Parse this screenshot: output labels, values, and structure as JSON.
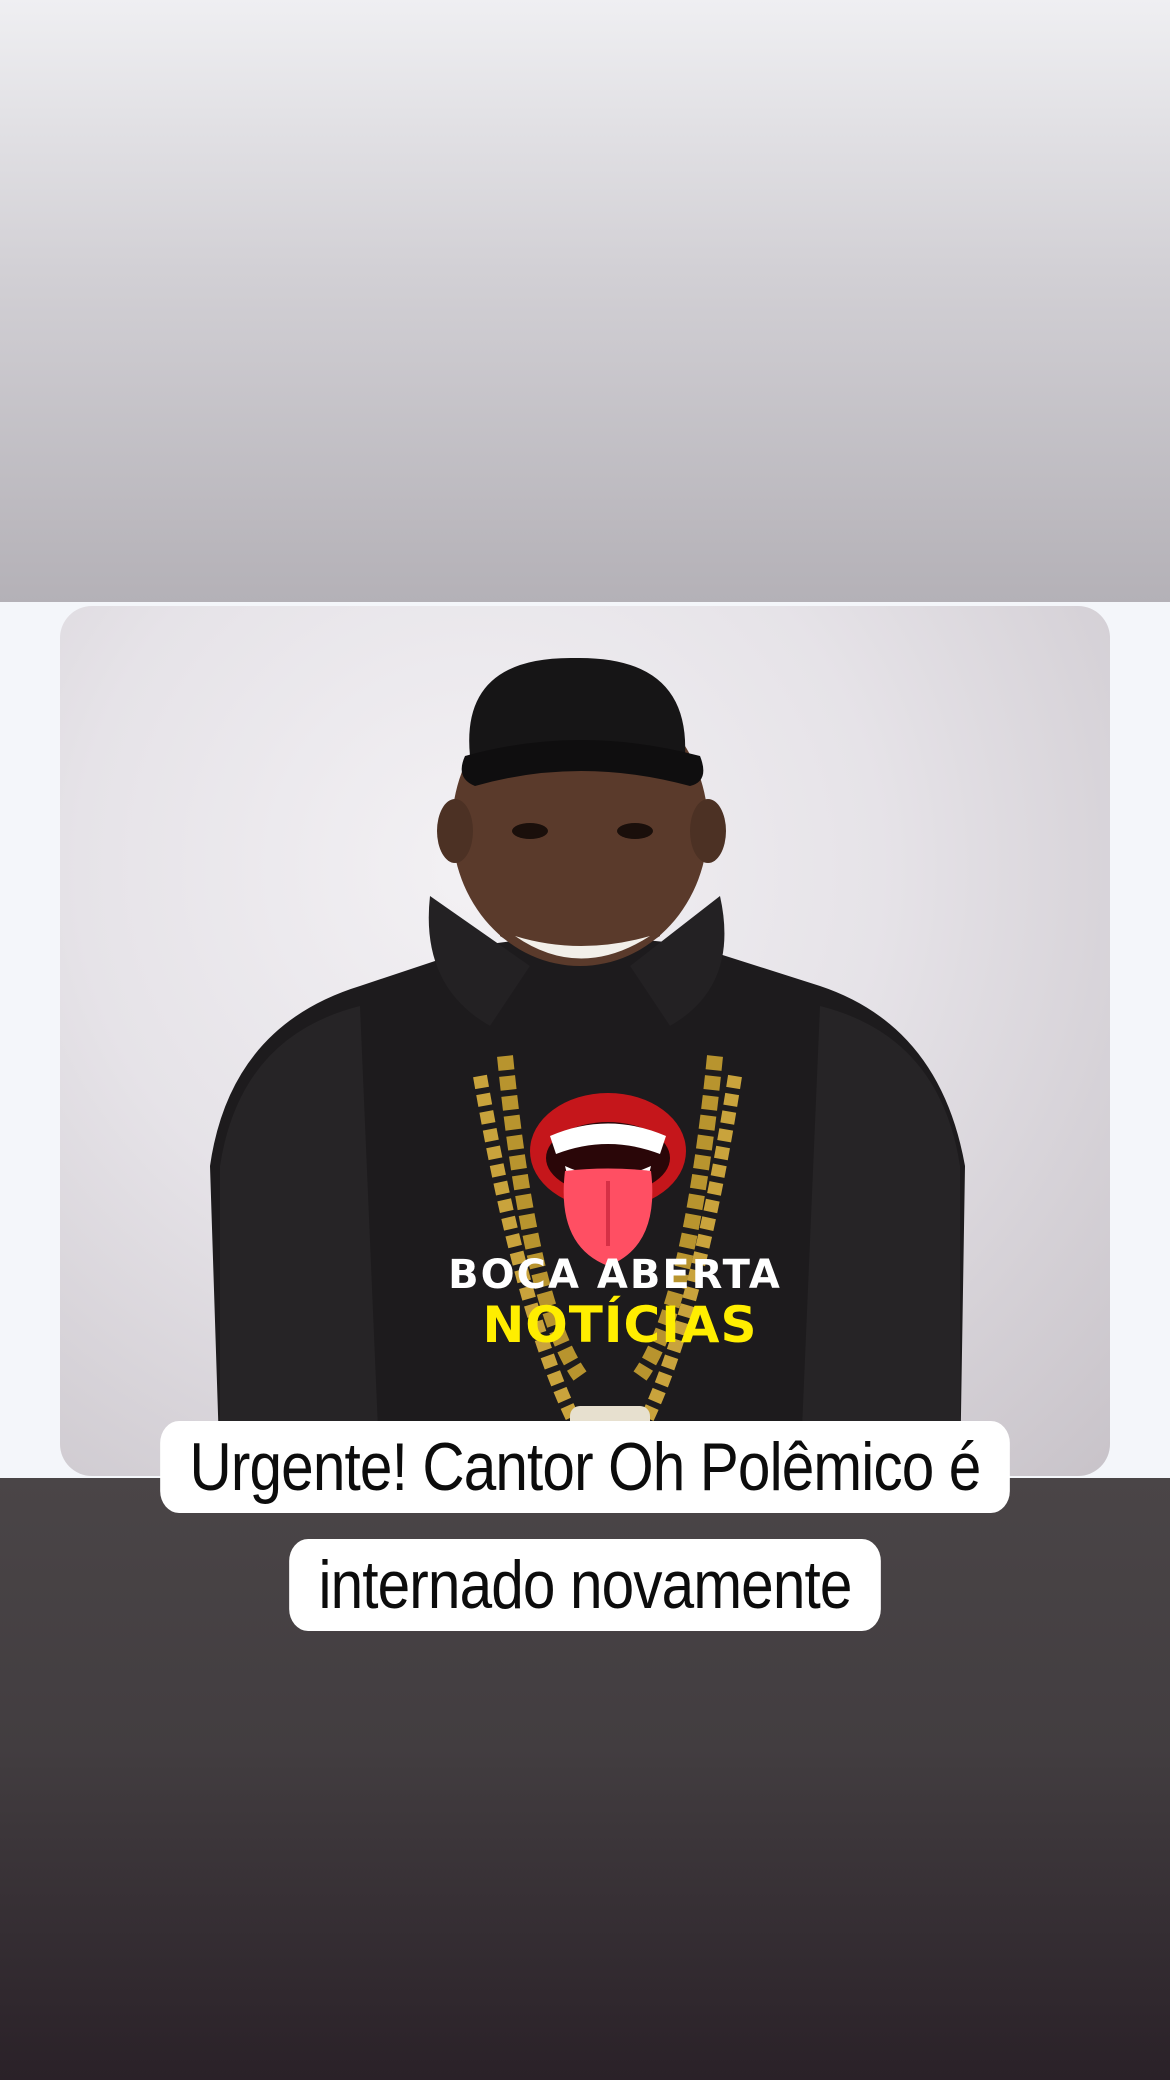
{
  "story": {
    "colors": {
      "top_background": "#d2d0d5",
      "middle_background": "#f4f6fa",
      "bottom_background": "#423d40",
      "caption_background": "#ffffff",
      "caption_text": "#0c0c0c",
      "logo_accent": "#ffee00"
    },
    "photo": {
      "subject": "man in black cap and black fleece hoodie with gold chain",
      "logo": {
        "icon": "open-mouth-tongue-icon",
        "line1": "BOCA ABERTA",
        "line2": "NOTÍCIAS"
      }
    },
    "caption": {
      "line1": "Urgente! Cantor Oh Polêmico é",
      "line2": "internado novamente"
    }
  }
}
